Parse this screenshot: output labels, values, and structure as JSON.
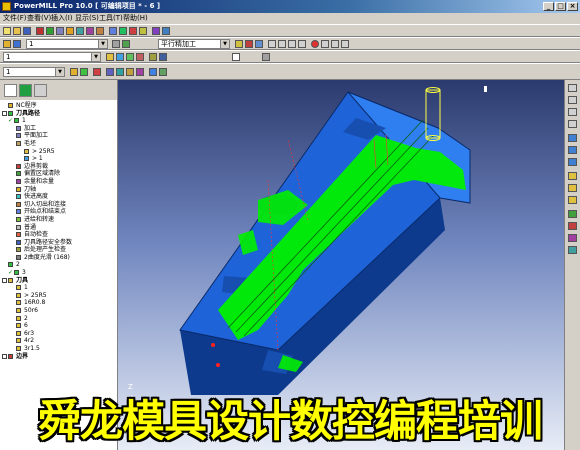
{
  "window": {
    "title": "PowerMILL Pro 10.0   [ 可编辑项目 * - 6 ]"
  },
  "menu": [
    "文件(F)",
    "查看(V)",
    "插入(I)",
    "显示(S)",
    "工具(T)",
    "帮助(H)"
  ],
  "toolbar": {
    "row2_combo": "1",
    "strategy_combo": "平行精加工",
    "row3_combo": "1",
    "row4_combo": "1"
  },
  "tree": {
    "root_nc": "NC程序",
    "toolpaths_label": "刀具路径",
    "items": [
      "1",
      "加工",
      "平面加工",
      "毛坯",
      "> 25R5",
      "> 1",
      "边界剪裁",
      "偏置区域清除",
      "余量和余量",
      "刀轴",
      "快进高度",
      "切入切出和连接",
      "开始点和结束点",
      "进给和转速",
      "普通",
      "自动检查",
      "刀具路径安全参数",
      "后处理产生检查",
      "2曲度光滑 (168)",
      "2",
      "3"
    ],
    "tools_label": "刀具",
    "tools": [
      "1",
      "> 25R5",
      "16R0.8",
      "50r6",
      "2",
      "6",
      "6r3",
      "4r2",
      "3r1.5"
    ],
    "boundary_label": "边界"
  },
  "viewport": {
    "axis_label": "Z"
  },
  "banner": {
    "text": "舜龙模具设计数控编程培训"
  },
  "colors": {
    "model_blue": "#1e64d8",
    "model_dark": "#0d3a8c",
    "toolpath_green": "#00f000",
    "banner_yellow": "#ffff00",
    "bg_top": "#2b3a6e",
    "bg_bottom": "#e7ecf6"
  }
}
